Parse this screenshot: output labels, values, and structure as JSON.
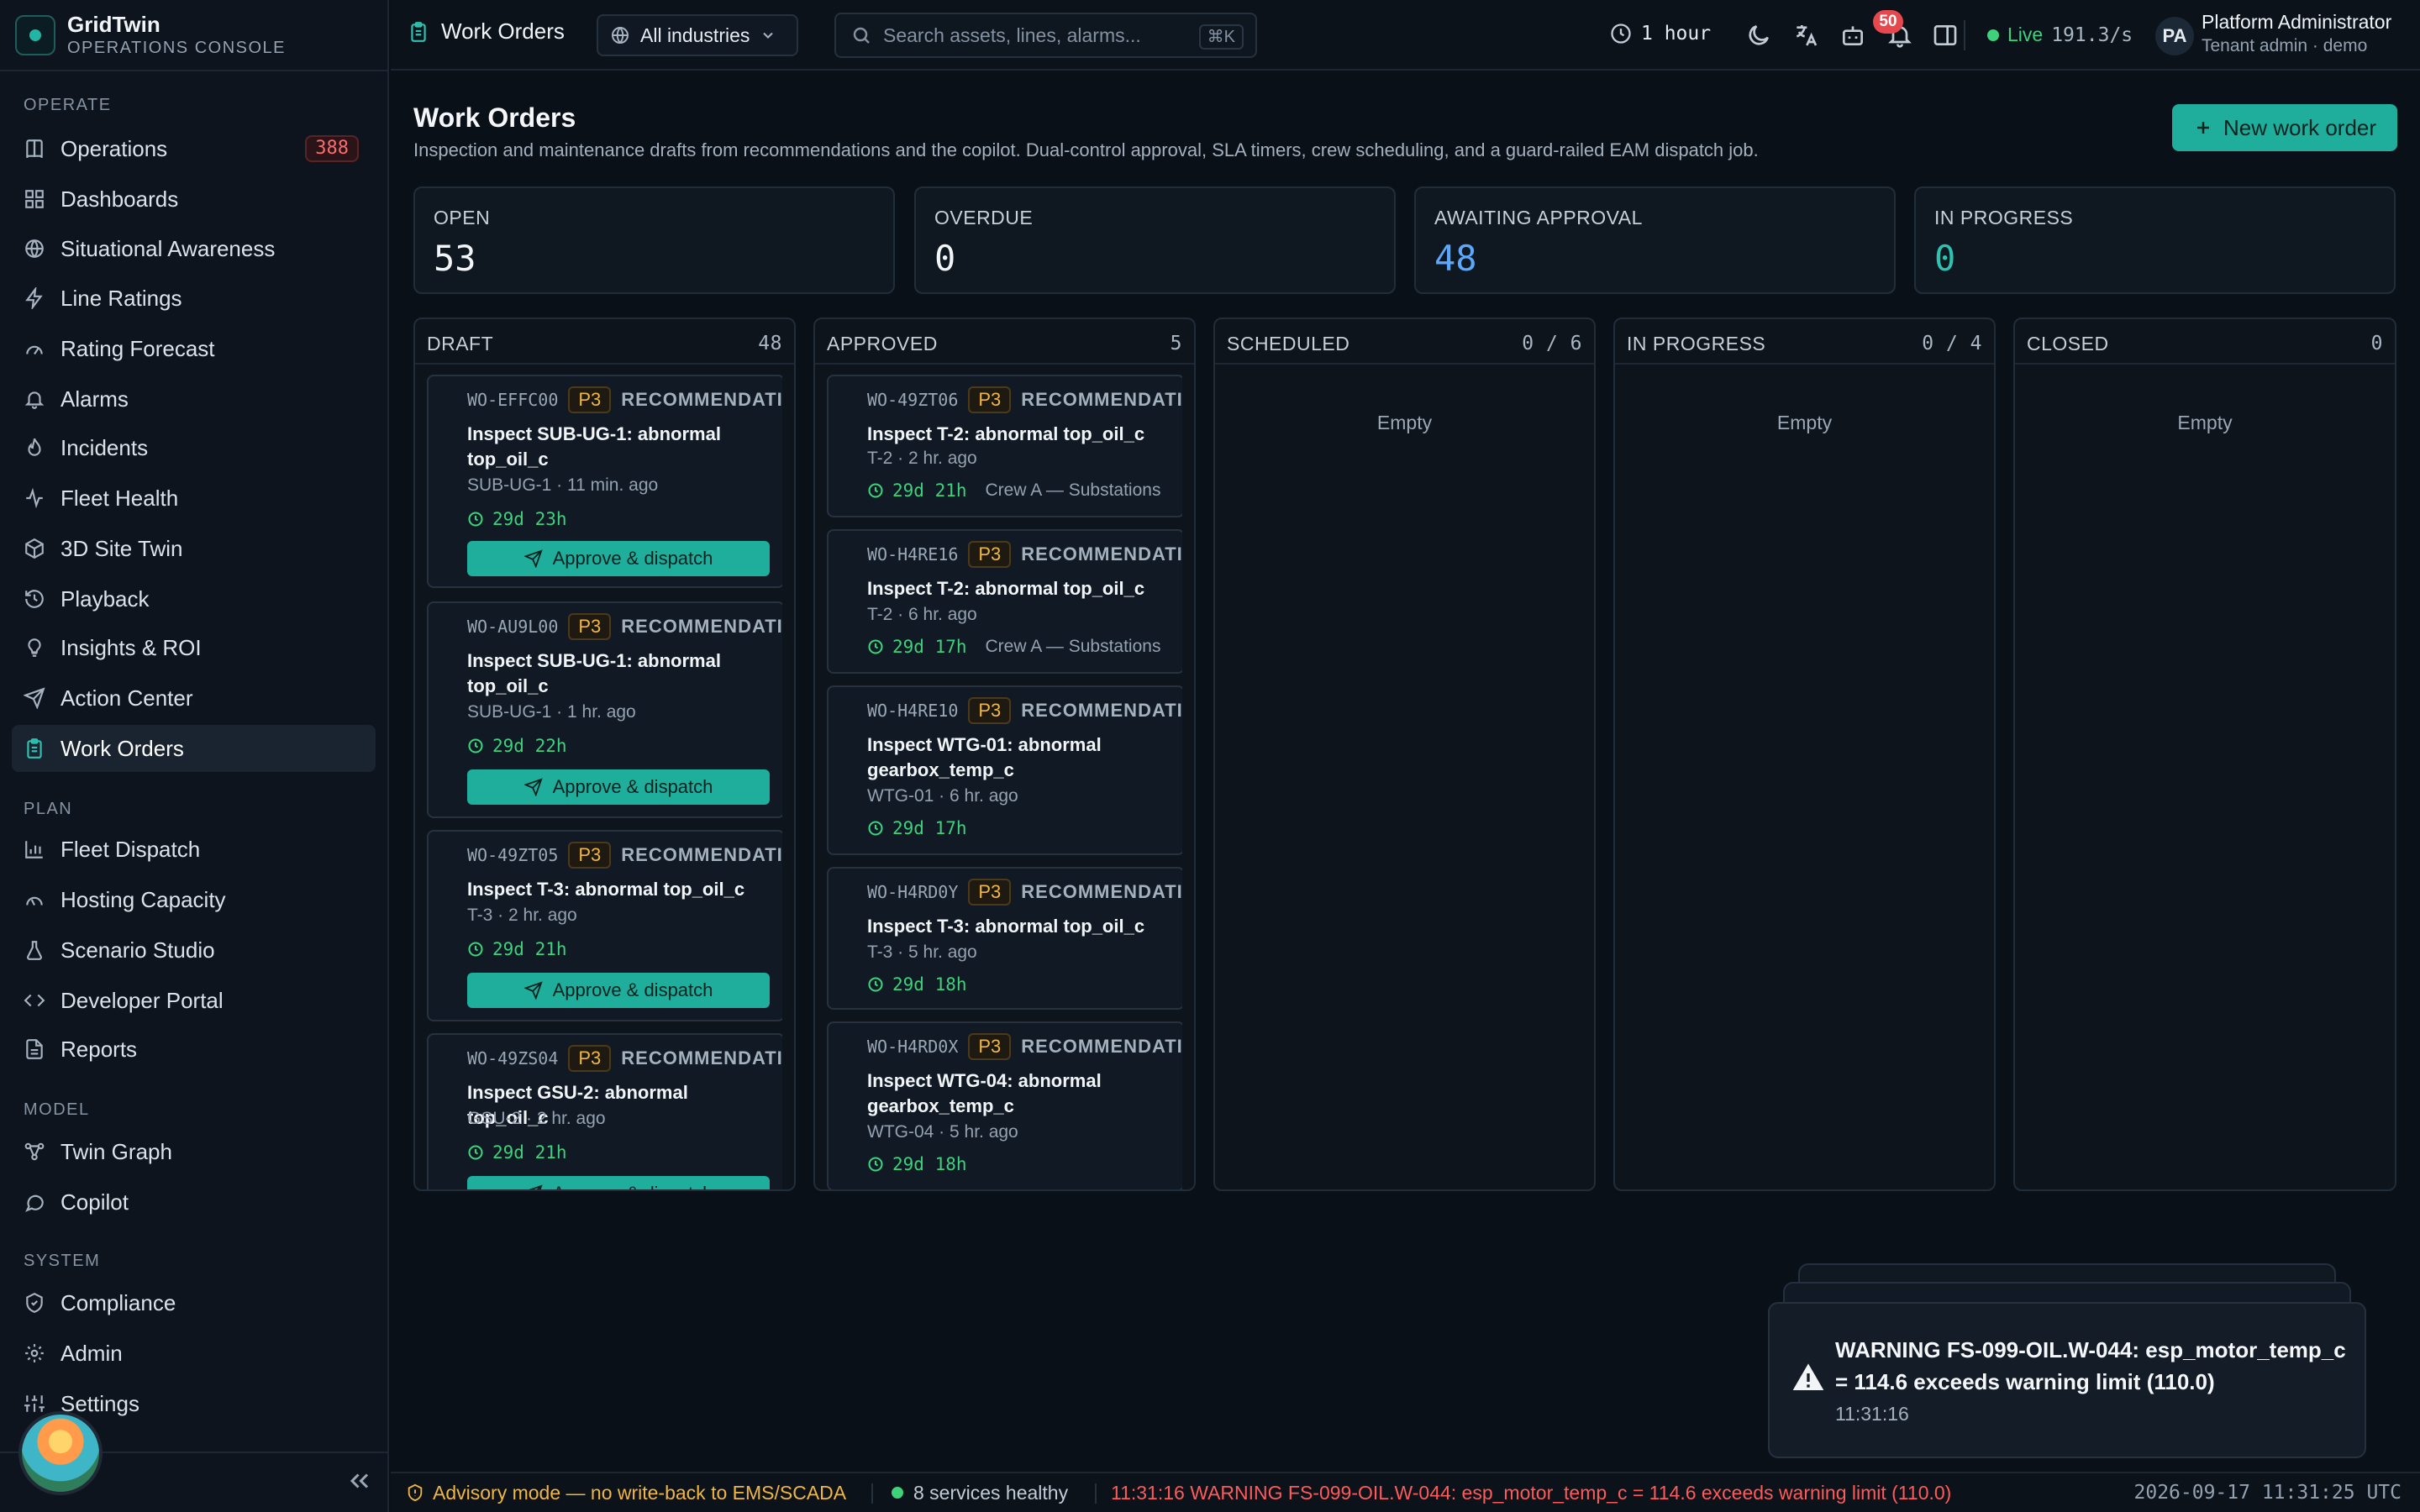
{
  "brand": {
    "name": "GridTwin",
    "subtitle": "OPERATIONS CONSOLE"
  },
  "sidebar": {
    "sections": [
      {
        "label": "OPERATE",
        "items": [
          {
            "label": "Operations",
            "icon": "book-icon",
            "badge": "388"
          },
          {
            "label": "Dashboards",
            "icon": "grid-icon"
          },
          {
            "label": "Situational Awareness",
            "icon": "globe-icon"
          },
          {
            "label": "Line Ratings",
            "icon": "bolt-icon"
          },
          {
            "label": "Rating Forecast",
            "icon": "gauge-icon"
          },
          {
            "label": "Alarms",
            "icon": "bell-icon"
          },
          {
            "label": "Incidents",
            "icon": "flame-icon"
          },
          {
            "label": "Fleet Health",
            "icon": "pulse-icon"
          },
          {
            "label": "3D Site Twin",
            "icon": "cube-icon"
          },
          {
            "label": "Playback",
            "icon": "history-icon"
          },
          {
            "label": "Insights & ROI",
            "icon": "bulb-icon"
          },
          {
            "label": "Action Center",
            "icon": "send-icon"
          },
          {
            "label": "Work Orders",
            "icon": "clipboard-icon",
            "active": true
          }
        ]
      },
      {
        "label": "PLAN",
        "items": [
          {
            "label": "Fleet Dispatch",
            "icon": "bar-chart-icon"
          },
          {
            "label": "Hosting Capacity",
            "icon": "gauge-icon"
          },
          {
            "label": "Scenario Studio",
            "icon": "flask-icon"
          },
          {
            "label": "Developer Portal",
            "icon": "code-icon"
          },
          {
            "label": "Reports",
            "icon": "file-icon"
          }
        ]
      },
      {
        "label": "MODEL",
        "items": [
          {
            "label": "Twin Graph",
            "icon": "graph-icon"
          },
          {
            "label": "Copilot",
            "icon": "chat-icon"
          }
        ]
      },
      {
        "label": "SYSTEM",
        "items": [
          {
            "label": "Compliance",
            "icon": "shield-icon"
          },
          {
            "label": "Admin",
            "icon": "gear-icon"
          },
          {
            "label": "Settings",
            "icon": "sliders-icon"
          }
        ]
      }
    ]
  },
  "topbar": {
    "page": "Work Orders",
    "industry": "All industries",
    "search_placeholder": "Search assets, lines, alarms...",
    "search_shortcut": "⌘K",
    "time_range": "1 hour",
    "notifications": "50",
    "live_label": "Live",
    "live_rate": "191.3/s",
    "user_initials": "PA",
    "user_name": "Platform Administrator",
    "user_role": "Tenant admin · demo"
  },
  "header": {
    "title": "Work Orders",
    "subtitle": "Inspection and maintenance drafts from recommendations and the copilot. Dual-control approval, SLA timers, crew scheduling, and a guard-railed EAM dispatch job.",
    "new_button": "New work order"
  },
  "stats": [
    {
      "label": "OPEN",
      "value": "53"
    },
    {
      "label": "OVERDUE",
      "value": "0"
    },
    {
      "label": "AWAITING APPROVAL",
      "value": "48"
    },
    {
      "label": "IN PROGRESS",
      "value": "0"
    }
  ],
  "columns": [
    {
      "label": "DRAFT",
      "count": "48",
      "cards": [
        {
          "id": "WO-EFFC00",
          "priority": "P3",
          "kind": "RECOMMENDATION",
          "title": "Inspect SUB-UG-1: abnormal top_oil_c",
          "asset": "SUB-UG-1 · 11 min. ago",
          "sla": "29d 23h",
          "action": "Approve & dispatch"
        },
        {
          "id": "WO-AU9L00",
          "priority": "P3",
          "kind": "RECOMMENDATION",
          "title": "Inspect SUB-UG-1: abnormal top_oil_c",
          "asset": "SUB-UG-1 · 1 hr. ago",
          "sla": "29d 22h",
          "action": "Approve & dispatch"
        },
        {
          "id": "WO-49ZT05",
          "priority": "P3",
          "kind": "RECOMMENDATION",
          "title": "Inspect T-3: abnormal top_oil_c",
          "asset": "T-3 · 2 hr. ago",
          "sla": "29d 21h",
          "action": "Approve & dispatch"
        },
        {
          "id": "WO-49ZS04",
          "priority": "P3",
          "kind": "RECOMMENDATION",
          "title": "Inspect GSU-2: abnormal top_oil_c",
          "asset": "GSU-2 · 2 hr. ago",
          "sla": "29d 21h",
          "action": "Approve & dispatch"
        }
      ]
    },
    {
      "label": "APPROVED",
      "count": "5",
      "cards": [
        {
          "id": "WO-49ZT06",
          "priority": "P3",
          "kind": "RECOMMENDATION",
          "title": "Inspect T-2: abnormal top_oil_c",
          "asset": "T-2 · 2 hr. ago",
          "sla": "29d 21h",
          "crew": "Crew A — Substations"
        },
        {
          "id": "WO-H4RE16",
          "priority": "P3",
          "kind": "RECOMMENDATION",
          "title": "Inspect T-2: abnormal top_oil_c",
          "asset": "T-2 · 6 hr. ago",
          "sla": "29d 17h",
          "crew": "Crew A — Substations"
        },
        {
          "id": "WO-H4RE10",
          "priority": "P3",
          "kind": "RECOMMENDATION",
          "title": "Inspect WTG-01: abnormal gearbox_temp_c",
          "asset": "WTG-01 · 6 hr. ago",
          "sla": "29d 17h"
        },
        {
          "id": "WO-H4RD0Y",
          "priority": "P3",
          "kind": "RECOMMENDATION",
          "title": "Inspect T-3: abnormal top_oil_c",
          "asset": "T-3 · 5 hr. ago",
          "sla": "29d 18h"
        },
        {
          "id": "WO-H4RD0X",
          "priority": "P3",
          "kind": "RECOMMENDATION",
          "title": "Inspect WTG-04: abnormal gearbox_temp_c",
          "asset": "WTG-04 · 5 hr. ago",
          "sla": "29d 18h"
        }
      ]
    },
    {
      "label": "SCHEDULED",
      "count": "0 / 6",
      "empty": "Empty"
    },
    {
      "label": "IN PROGRESS",
      "count": "0 / 4",
      "empty": "Empty"
    },
    {
      "label": "CLOSED",
      "count": "0",
      "empty": "Empty"
    }
  ],
  "toast": {
    "message": "WARNING FS-099-OIL.W-044: esp_motor_temp_c = 114.6 exceeds warning limit (110.0)",
    "time": "11:31:16"
  },
  "statusbar": {
    "advisory": "Advisory mode — no write-back to EMS/SCADA",
    "services": "8 services healthy",
    "alert": "11:31:16 WARNING FS-099-OIL.W-044: esp_motor_temp_c = 114.6 exceeds warning limit (110.0)",
    "clock": "2026-09-17 11:31:25 UTC"
  },
  "colors": {
    "accent": "#1fae9c",
    "warning": "#f2b640",
    "danger": "#ff5a5a",
    "ok": "#3ed17c",
    "info": "#5ba9ff"
  }
}
